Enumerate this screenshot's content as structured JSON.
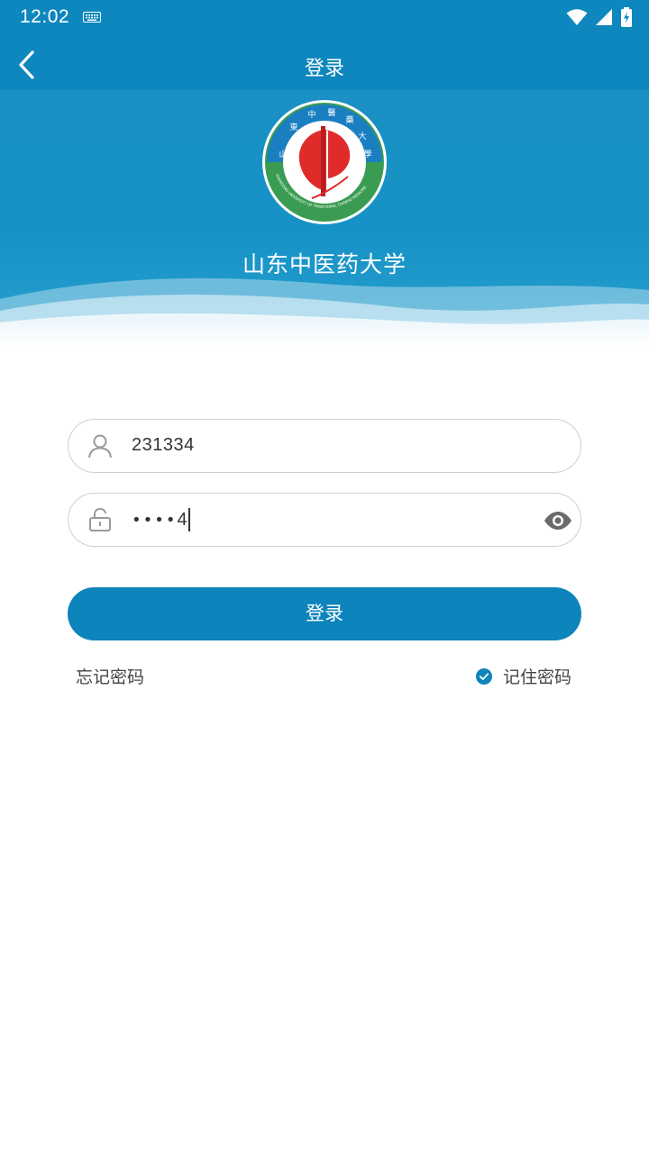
{
  "status_bar": {
    "time": "12:02"
  },
  "header": {
    "title": "登录"
  },
  "banner": {
    "logo_text": "山東中醫藥大學",
    "university_name": "山东中医药大学"
  },
  "form": {
    "username_value": "231334",
    "password_masked": "••••",
    "password_last_char": "4",
    "login_button": "登录",
    "forgot_password": "忘记密码",
    "remember_password": "记住密码",
    "remember_checked": true
  },
  "colors": {
    "primary": "#0d87bd",
    "button": "#0d84bb",
    "logo_green": "#3a9c52",
    "logo_red": "#e02b2b"
  }
}
